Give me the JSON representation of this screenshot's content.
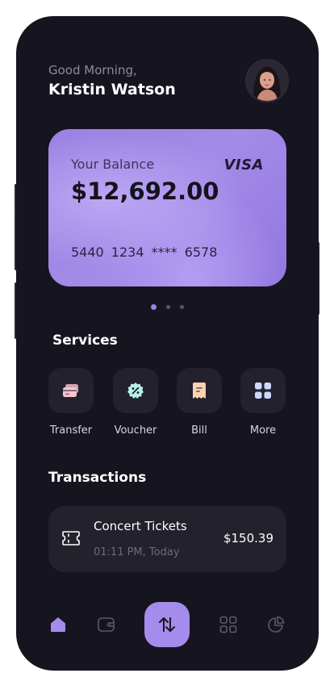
{
  "header": {
    "greeting": "Good Morning,",
    "user_name": "Kristin Watson"
  },
  "card": {
    "label": "Your Balance",
    "brand": "VISA",
    "balance": "$12,692.00",
    "number": "5440 1234 **** 6578"
  },
  "carousel": {
    "count": 3,
    "active_index": 0
  },
  "services": {
    "title": "Services",
    "items": [
      {
        "label": "Transfer",
        "icon": "card-transfer-icon"
      },
      {
        "label": "Voucher",
        "icon": "voucher-percent-icon"
      },
      {
        "label": "Bill",
        "icon": "bill-receipt-icon"
      },
      {
        "label": "More",
        "icon": "grid-more-icon"
      }
    ]
  },
  "transactions": {
    "title": "Transactions",
    "items": [
      {
        "title": "Concert Tickets",
        "time": "01:11 PM, Today",
        "amount": "$150.39",
        "icon": "ticket-icon"
      }
    ]
  },
  "nav": {
    "items": [
      "home-icon",
      "wallet-icon",
      "transfer-arrows-icon",
      "apps-grid-icon",
      "pie-chart-icon"
    ],
    "active": "home-icon"
  },
  "colors": {
    "background": "#16151f",
    "surface": "#22212c",
    "accent": "#a58bec",
    "card_gradient_start": "#9a82e3",
    "card_gradient_end": "#9277e0"
  }
}
